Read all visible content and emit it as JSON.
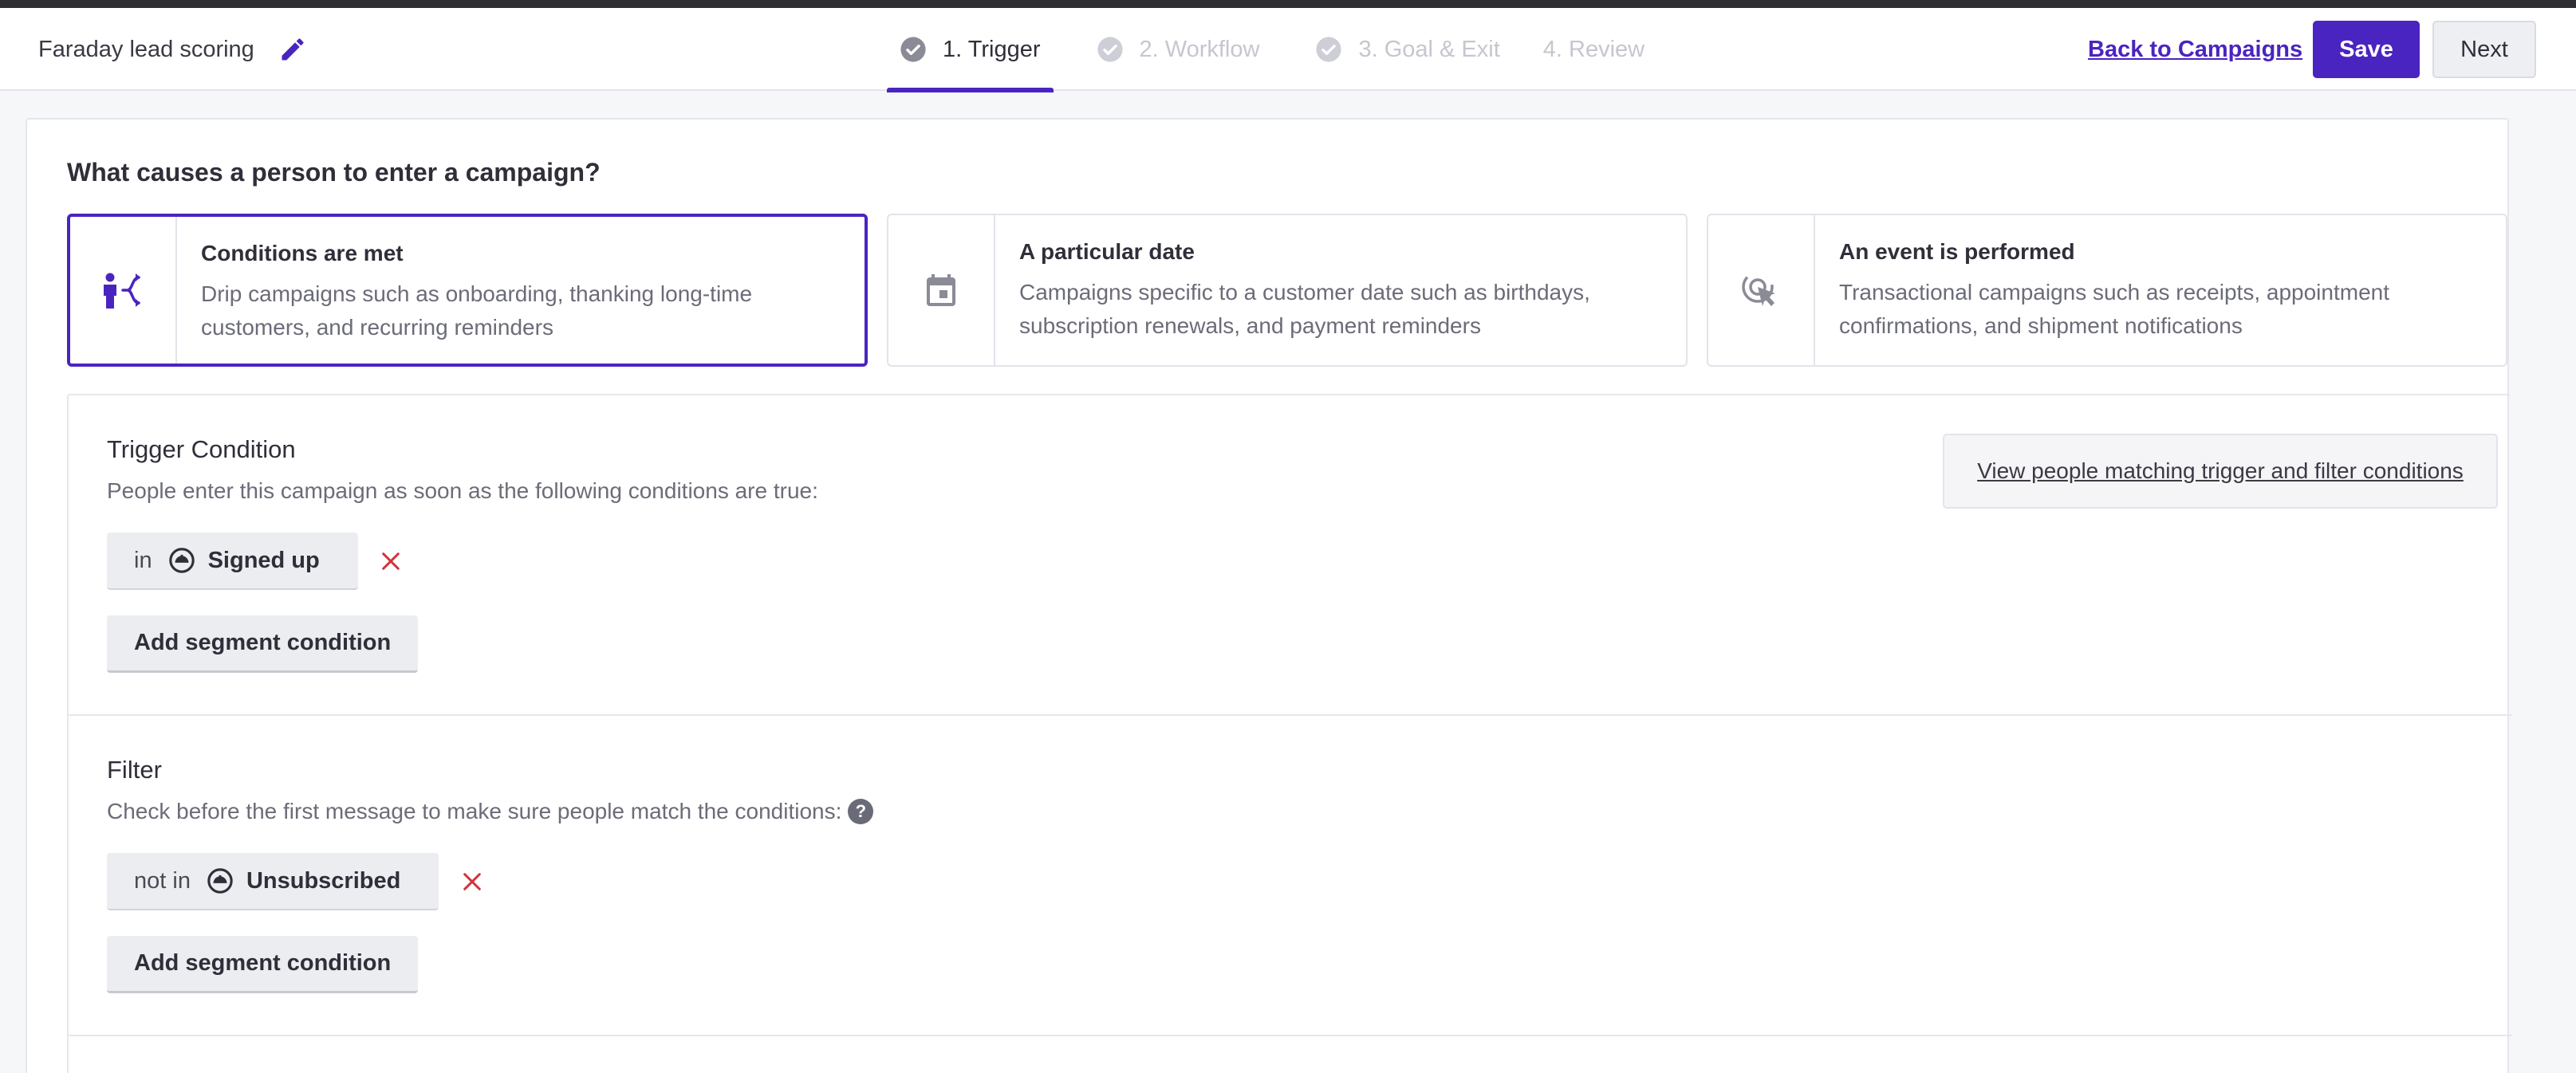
{
  "header": {
    "campaign_name": "Faraday lead scoring",
    "steps": [
      {
        "label": "1. Trigger",
        "active": true,
        "icon": "check-circle-icon"
      },
      {
        "label": "2. Workflow",
        "active": false,
        "icon": "check-circle-icon"
      },
      {
        "label": "3. Goal & Exit",
        "active": false,
        "icon": "check-circle-icon"
      },
      {
        "label": "4. Review",
        "active": false
      }
    ],
    "back_link": "Back to Campaigns",
    "save_label": "Save",
    "next_label": "Next"
  },
  "main": {
    "question": "What causes a person to enter a campaign?",
    "options": [
      {
        "title": "Conditions are met",
        "desc_line1": "Drip campaigns such as onboarding, thanking long-time",
        "desc_line2": "customers, and recurring reminders",
        "icon": "person-branch-icon",
        "selected": true
      },
      {
        "title": "A particular date",
        "desc_line1": "Campaigns specific to a customer date such as birthdays,",
        "desc_line2": "subscription renewals, and payment reminders",
        "icon": "calendar-icon",
        "selected": false
      },
      {
        "title": "An event is performed",
        "desc_line1": "Transactional campaigns such as receipts, appointment",
        "desc_line2": "confirmations, and shipment notifications",
        "icon": "cursor-click-icon",
        "selected": false
      }
    ]
  },
  "trigger": {
    "title": "Trigger Condition",
    "description": "People enter this campaign as soon as the following conditions are true:",
    "view_link": "View people matching trigger and filter conditions",
    "condition": {
      "prefix": "in",
      "segment": "Signed up"
    },
    "add_label": "Add segment condition"
  },
  "filter": {
    "title": "Filter",
    "description": "Check before the first message to make sure people match the conditions:",
    "help": "?",
    "condition": {
      "prefix": "not in",
      "segment": "Unsubscribed"
    },
    "add_label": "Add segment condition"
  },
  "colors": {
    "accent": "#4a24c0",
    "remove": "#d0343a"
  }
}
